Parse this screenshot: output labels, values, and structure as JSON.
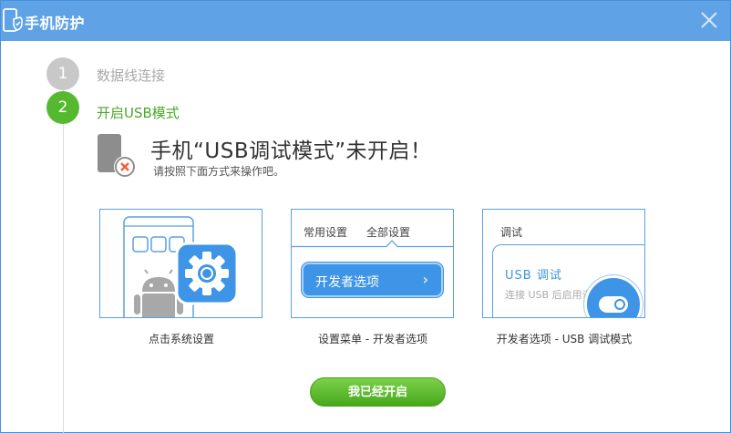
{
  "window": {
    "title": "手机防护"
  },
  "steps": [
    {
      "number": "1",
      "label": "数据线连接"
    },
    {
      "number": "2",
      "label": "开启USB模式"
    }
  ],
  "headline": {
    "title": "手机“USB调试模式”未开启！",
    "subtitle": "请按照下面方式来操作吧。"
  },
  "cards": [
    {
      "caption": "点击系统设置",
      "icon": "settings-gear-icon"
    },
    {
      "caption": "设置菜单 - 开发者选项",
      "tabs": [
        "常用设置",
        "全部设置"
      ],
      "button_label": "开发者选项",
      "button_arrow": "›"
    },
    {
      "caption": "开发者选项 - USB 调试模式",
      "title": "调试",
      "option_label": "USB 调试",
      "option_desc": "连接 USB 后启用调试模式"
    }
  ],
  "confirm_button": "我已经开启",
  "colors": {
    "titlebar": "#5fa3e6",
    "accent_blue": "#3e94e6",
    "accent_green": "#55b930",
    "inactive_gray": "#c8c8c8"
  }
}
